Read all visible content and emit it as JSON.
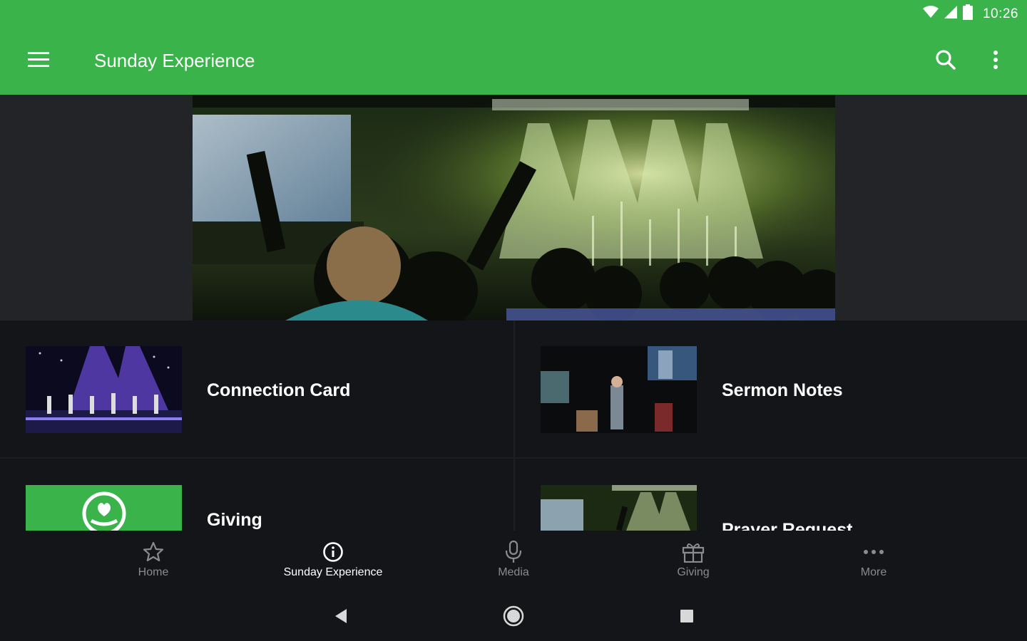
{
  "status_bar": {
    "time": "10:26",
    "icons": [
      "wifi-icon",
      "signal-icon",
      "battery-icon"
    ]
  },
  "app_bar": {
    "title": "Sunday Experience",
    "icons": [
      "menu-icon",
      "search-icon",
      "more-vertical-icon"
    ]
  },
  "tiles": [
    {
      "label": "Connection Card"
    },
    {
      "label": "Sermon Notes"
    },
    {
      "label": "Giving"
    },
    {
      "label": "Prayer Request"
    }
  ],
  "bottom_nav": [
    {
      "label": "Home",
      "icon": "star-icon"
    },
    {
      "label": "Sunday Experience",
      "icon": "info-icon",
      "active": true
    },
    {
      "label": "Media",
      "icon": "microphone-icon"
    },
    {
      "label": "Giving",
      "icon": "gift-icon"
    },
    {
      "label": "More",
      "icon": "more-horizontal-icon"
    }
  ],
  "system_nav": [
    "back-icon",
    "home-icon",
    "recents-icon"
  ],
  "colors": {
    "brand_green": "#3ab44a",
    "background": "#141518",
    "hero_band": "#232427"
  }
}
